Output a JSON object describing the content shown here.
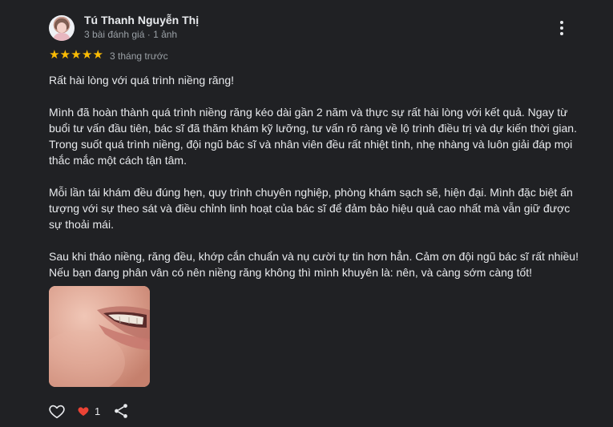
{
  "reviewer": {
    "name": "Tú Thanh Nguyễn Thị",
    "meta": "3 bài đánh giá · 1 ảnh"
  },
  "rating": {
    "stars": 5,
    "max": 5,
    "star_glyph": "★",
    "color": "#fbbc04"
  },
  "date": "3 tháng trước",
  "review": {
    "paragraphs": [
      "Rất hài lòng với quá trình niềng răng!",
      "Mình đã hoàn thành quá trình niềng răng kéo dài gần 2 năm và thực sự rất hài lòng với kết quả. Ngay từ buổi tư vấn đầu tiên, bác sĩ đã thăm khám kỹ lưỡng, tư vấn rõ ràng về lộ trình điều trị và dự kiến thời gian. Trong suốt quá trình niềng, đội ngũ bác sĩ và nhân viên đều rất nhiệt tình, nhẹ nhàng và luôn giải đáp mọi thắc mắc một cách tận tâm.",
      "Mỗi lần tái khám đều đúng hẹn, quy trình chuyên nghiệp, phòng khám sạch sẽ, hiện đại. Mình đặc biệt ấn tượng với sự theo sát và điều chỉnh linh hoạt của bác sĩ để đảm bảo hiệu quả cao nhất mà vẫn giữ được sự thoải mái.",
      "Sau khi tháo niềng, răng đều, khớp cắn chuẩn và nụ cười tự tin hơn hẳn. Cảm ơn đội ngũ bác sĩ rất nhiều! Nếu bạn đang phân vân có nên niềng răng không thì mình khuyên là: nên, và càng sớm càng tốt!"
    ]
  },
  "actions": {
    "like_icon": "thumb-up-outline",
    "reaction_icon": "heart",
    "reaction_count": "1",
    "share_icon": "share",
    "reaction_color": "#ea4335"
  },
  "colors": {
    "background": "#202124",
    "text": "#e8eaed",
    "secondary_text": "#9aa0a6"
  }
}
